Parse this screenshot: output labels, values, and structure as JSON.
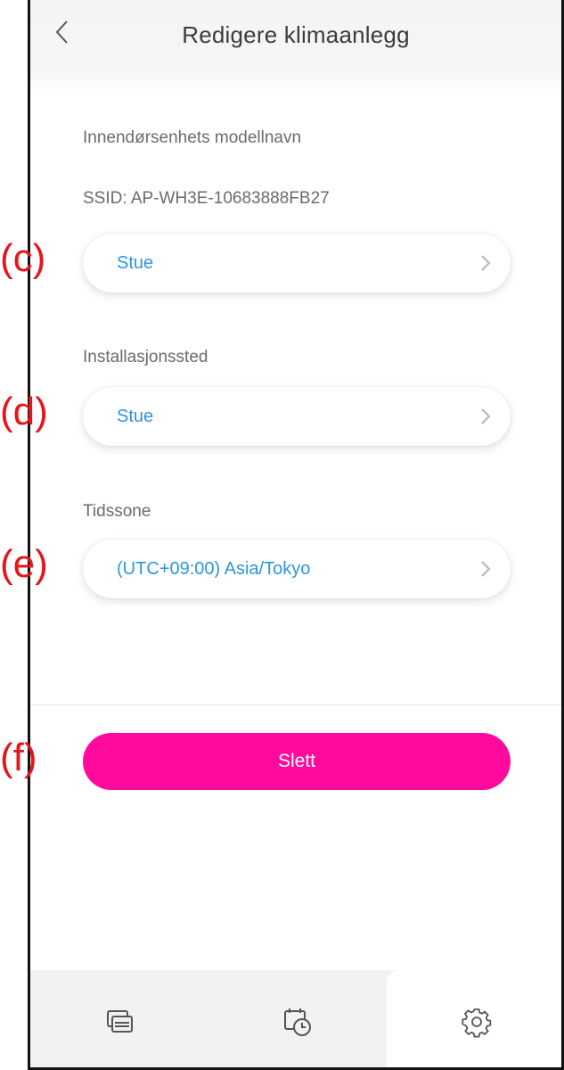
{
  "header": {
    "title": "Redigere klimaanlegg",
    "back_icon": "chevron-left-icon"
  },
  "info": {
    "model_label": "Innendørsenhets modellnavn",
    "ssid_label": "SSID: AP-WH3E-10683888FB27"
  },
  "fields": {
    "name_value": "Stue",
    "location_label": "Installasjonssted",
    "location_value": "Stue",
    "timezone_label": "Tidssone",
    "timezone_value": "(UTC+09:00) Asia/Tokyo"
  },
  "actions": {
    "delete_label": "Slett"
  },
  "tabbar": {
    "tabs": [
      {
        "icon": "devices-icon",
        "selected": false
      },
      {
        "icon": "timer-schedule-icon",
        "selected": false
      },
      {
        "icon": "gear-icon",
        "selected": true
      }
    ]
  },
  "annotations": {
    "c": "(c)",
    "d": "(d)",
    "e": "(e)",
    "f": "(f)"
  },
  "colors": {
    "accent_value": "#2f95dc",
    "delete_button": "#ff0a9c",
    "annotation": "#e8141b"
  }
}
